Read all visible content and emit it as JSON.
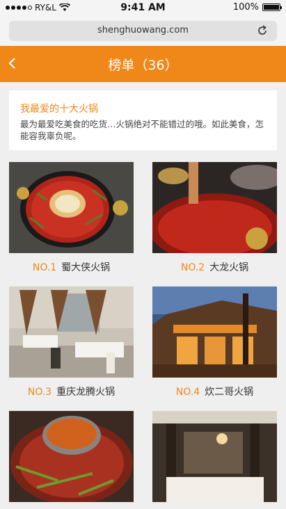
{
  "status_bar": {
    "carrier": "RY&L",
    "time": "9:41 AM",
    "battery": "100%"
  },
  "browser": {
    "url": "shenghuowang.com"
  },
  "nav": {
    "title": "榜单（36）"
  },
  "intro": {
    "title": "我最爱的十大火锅",
    "text": "最为最爱吃美食的吃货…火锅绝对不能错过的哦。如此美食，怎能容我辜负呢。"
  },
  "items": [
    {
      "rank": "NO.1",
      "name": "蜀大侠火锅"
    },
    {
      "rank": "NO.2",
      "name": "大龙火锅"
    },
    {
      "rank": "NO.3",
      "name": "重庆龙腾火锅"
    },
    {
      "rank": "NO.4",
      "name": "炊二哥火锅"
    }
  ],
  "colors": {
    "accent": "#f08719"
  }
}
